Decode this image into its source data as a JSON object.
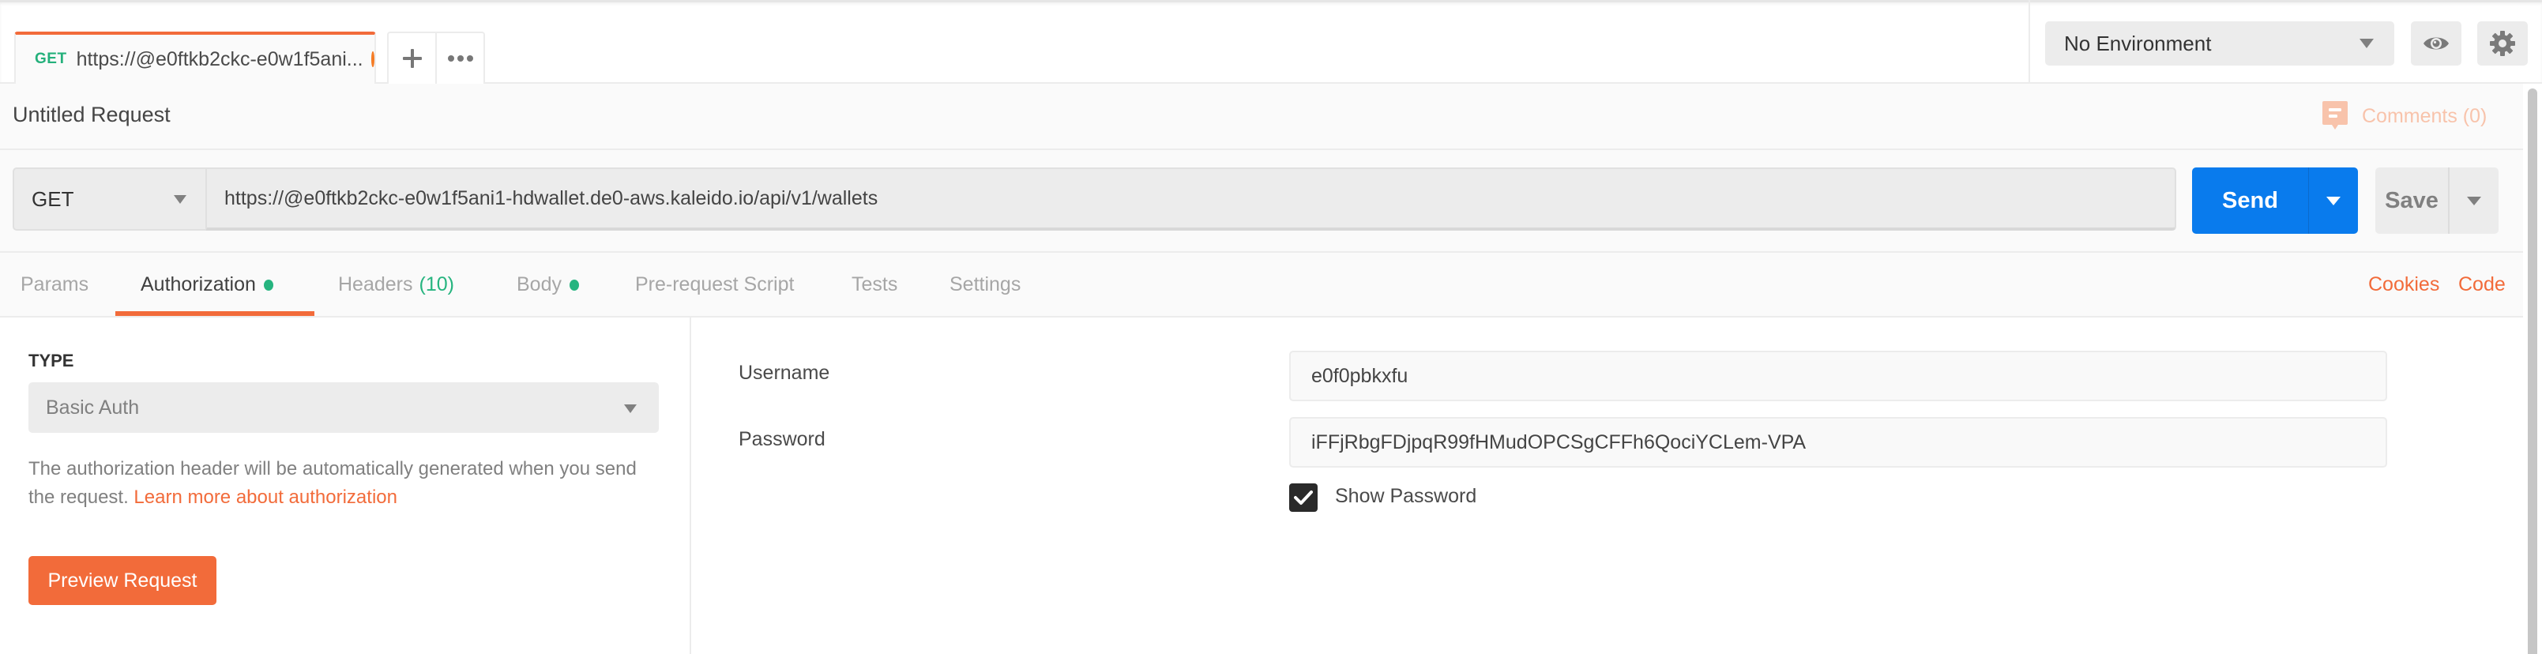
{
  "tab_bar": {
    "active_tab": {
      "method": "GET",
      "title": "https://@e0ftkb2ckc-e0w1f5ani...",
      "unsaved": true
    },
    "new_tab_icon": "plus-icon",
    "more_icon": "ellipsis-icon"
  },
  "environment": {
    "selected": "No Environment",
    "quick_look_icon": "eye-icon",
    "settings_icon": "gear-icon"
  },
  "request": {
    "name": "Untitled Request",
    "comments_label": "Comments (0)",
    "method": "GET",
    "url": "https://@e0ftkb2ckc-e0w1f5ani1-hdwallet.de0-aws.kaleido.io/api/v1/wallets",
    "send_label": "Send",
    "save_label": "Save"
  },
  "request_tabs": {
    "items": [
      {
        "label": "Params",
        "active": false
      },
      {
        "label": "Authorization",
        "active": true,
        "indicator": true
      },
      {
        "label": "Headers",
        "count": "(10)",
        "active": false
      },
      {
        "label": "Body",
        "active": false,
        "indicator": true
      },
      {
        "label": "Pre-request Script",
        "active": false
      },
      {
        "label": "Tests",
        "active": false
      },
      {
        "label": "Settings",
        "active": false
      }
    ],
    "cookies_label": "Cookies",
    "code_label": "Code"
  },
  "auth": {
    "type_label": "TYPE",
    "type_value": "Basic Auth",
    "help_text": "The authorization header will be automatically generated when you send the request.",
    "help_link": "Learn more about authorization",
    "preview_label": "Preview Request",
    "username_label": "Username",
    "username_value": "e0f0pbkxfu",
    "password_label": "Password",
    "password_value": "iFFjRbgFDjpqR99fHMudOPCSgCFFh6QociYCLem-VPA",
    "show_password_label": "Show Password",
    "show_password_checked": true
  },
  "colors": {
    "accent": "#f26b3a",
    "send_blue": "#097bed",
    "indicator_green": "#26b47f"
  }
}
